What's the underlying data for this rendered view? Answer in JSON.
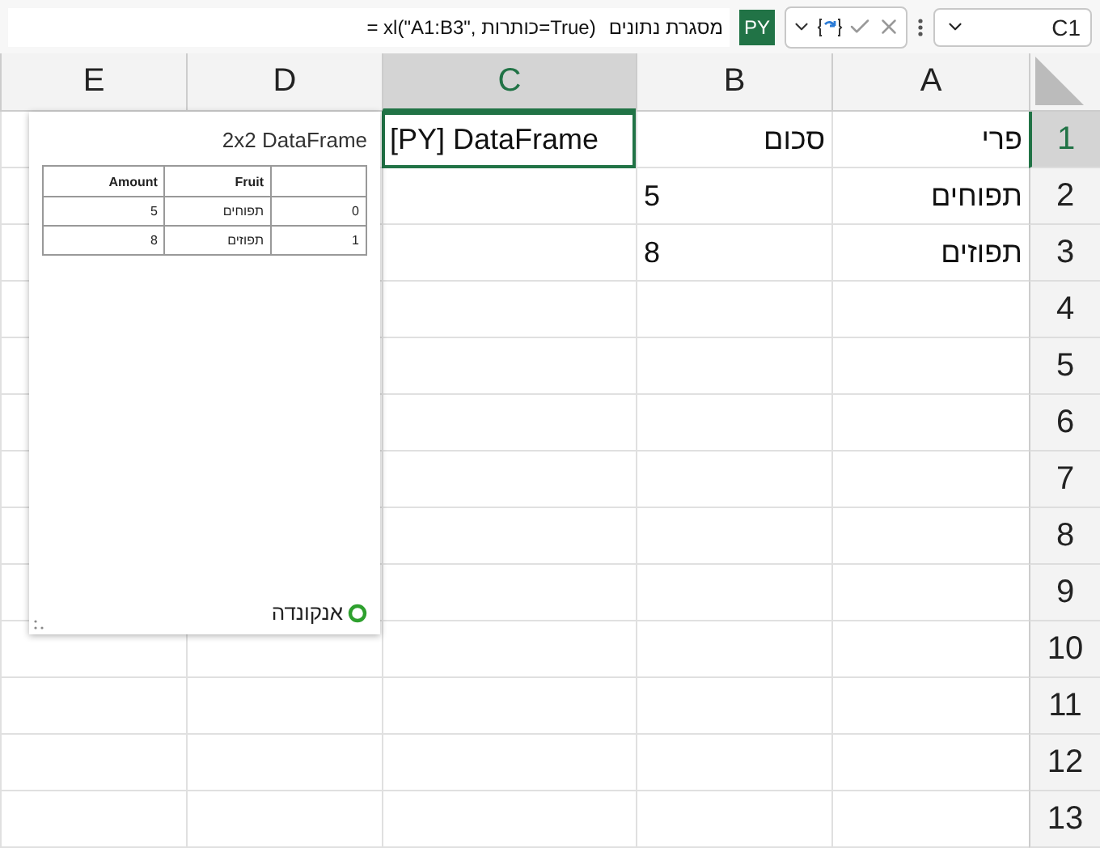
{
  "name_box": "C1",
  "formula": {
    "badge": "PY",
    "label": "מסגרת נתונים",
    "text": "= xl(\"A1:B3\", כותרות=True)"
  },
  "columns": [
    {
      "label": "A",
      "selected": false
    },
    {
      "label": "B",
      "selected": false
    },
    {
      "label": "C",
      "selected": true
    },
    {
      "label": "D",
      "selected": false
    },
    {
      "label": "E",
      "selected": false
    }
  ],
  "rows": [
    {
      "label": "1",
      "selected": true,
      "cells": [
        {
          "text": "פרי",
          "kind": "text",
          "selected": false
        },
        {
          "text": "סכום",
          "kind": "text",
          "selected": false
        },
        {
          "text": "[PY] DataFrame",
          "kind": "python",
          "selected": true
        }
      ]
    },
    {
      "label": "2",
      "selected": false,
      "cells": [
        {
          "text": "תפוחים",
          "kind": "text",
          "selected": false
        },
        {
          "text": "5",
          "kind": "number",
          "selected": false
        }
      ]
    },
    {
      "label": "3",
      "selected": false,
      "cells": [
        {
          "text": "תפוזים",
          "kind": "text",
          "selected": false
        },
        {
          "text": "8",
          "kind": "number",
          "selected": false
        }
      ]
    },
    {
      "label": "4",
      "selected": false,
      "cells": []
    },
    {
      "label": "5",
      "selected": false,
      "cells": []
    },
    {
      "label": "6",
      "selected": false,
      "cells": []
    },
    {
      "label": "7",
      "selected": false,
      "cells": []
    },
    {
      "label": "8",
      "selected": false,
      "cells": []
    },
    {
      "label": "9",
      "selected": false,
      "cells": []
    },
    {
      "label": "10",
      "selected": false,
      "cells": []
    },
    {
      "label": "11",
      "selected": false,
      "cells": []
    },
    {
      "label": "12",
      "selected": false,
      "cells": []
    },
    {
      "label": "13",
      "selected": false,
      "cells": []
    }
  ],
  "card": {
    "title": "2x2 DataFrame",
    "columns": [
      "",
      "Fruit",
      "Amount"
    ],
    "rows": [
      [
        "0",
        "תפוחים",
        "5"
      ],
      [
        "1",
        "תפוזים",
        "8"
      ]
    ],
    "footer": "אנקונדה"
  }
}
